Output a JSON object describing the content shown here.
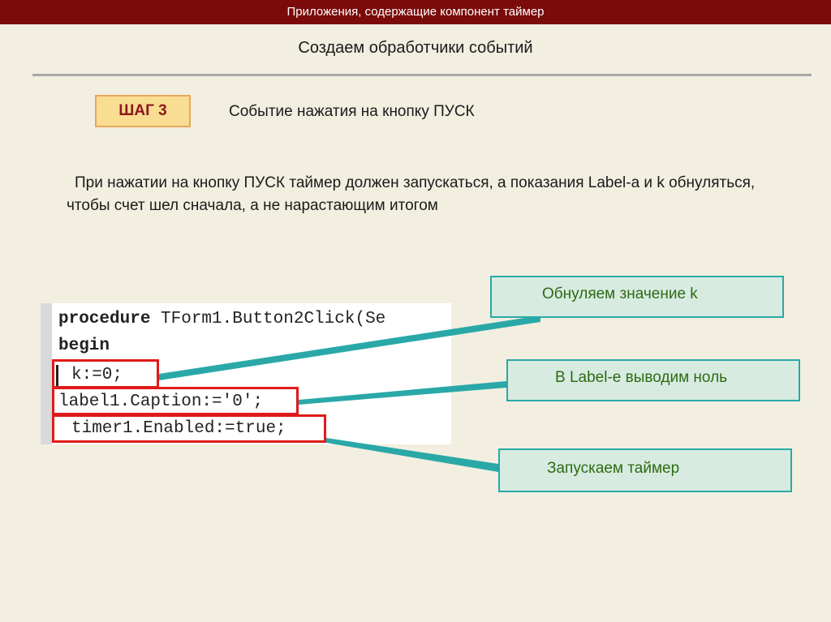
{
  "header": {
    "title": "Приложения, содержащие компонент таймер"
  },
  "slide": {
    "subtitle": "Создаем обработчики событий",
    "step_label": "ШАГ 3",
    "step_title": "Событие нажатия на кнопку ПУСК",
    "description": "При нажатии на кнопку ПУСК таймер должен запускаться, а показания Label-a и k обнуляться, чтобы счет шел сначала, а не нарастающим итогом"
  },
  "code": {
    "line1_keyword": "procedure",
    "line1_rest": " TForm1.Button2Click(Se",
    "line2": "begin",
    "line3": "k:=0;",
    "line4": "label1.Caption:='0';",
    "line5": "timer1.Enabled:=true;"
  },
  "callouts": {
    "reset_k": "Обнуляем значение k",
    "label_zero": "В Label-е выводим ноль",
    "start_timer": "Запускаем таймер"
  },
  "colors": {
    "top_bar": "#7b0a0a",
    "background": "#f2efe1",
    "highlight_box": "#e01a1a",
    "callout_border": "#2aa8a8",
    "callout_fill": "#d7ebe1",
    "callout_text": "#2e6b12",
    "step_fill": "#f8dd92",
    "step_text": "#8b1a1a"
  }
}
